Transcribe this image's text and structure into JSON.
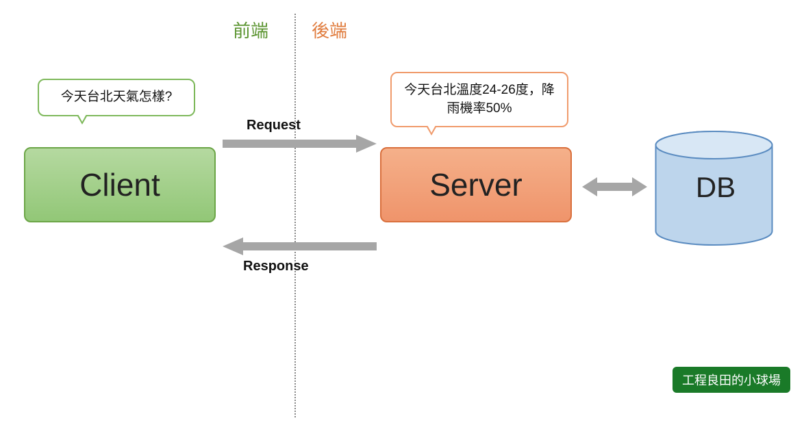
{
  "labels": {
    "frontend": "前端",
    "backend": "後端",
    "request": "Request",
    "response": "Response"
  },
  "client": {
    "box_label": "Client",
    "bubble": "今天台北天氣怎樣?"
  },
  "server": {
    "box_label": "Server",
    "bubble": "今天台北溫度24-26度，降雨機率50%"
  },
  "db": {
    "label": "DB"
  },
  "footer": "工程良田的小球場",
  "colors": {
    "frontend": "#5b9430",
    "backend": "#e07c3e",
    "client_box": "#92c777",
    "server_box": "#ef946b",
    "db_fill": "#bdd5ec",
    "arrow": "#a6a6a6"
  }
}
